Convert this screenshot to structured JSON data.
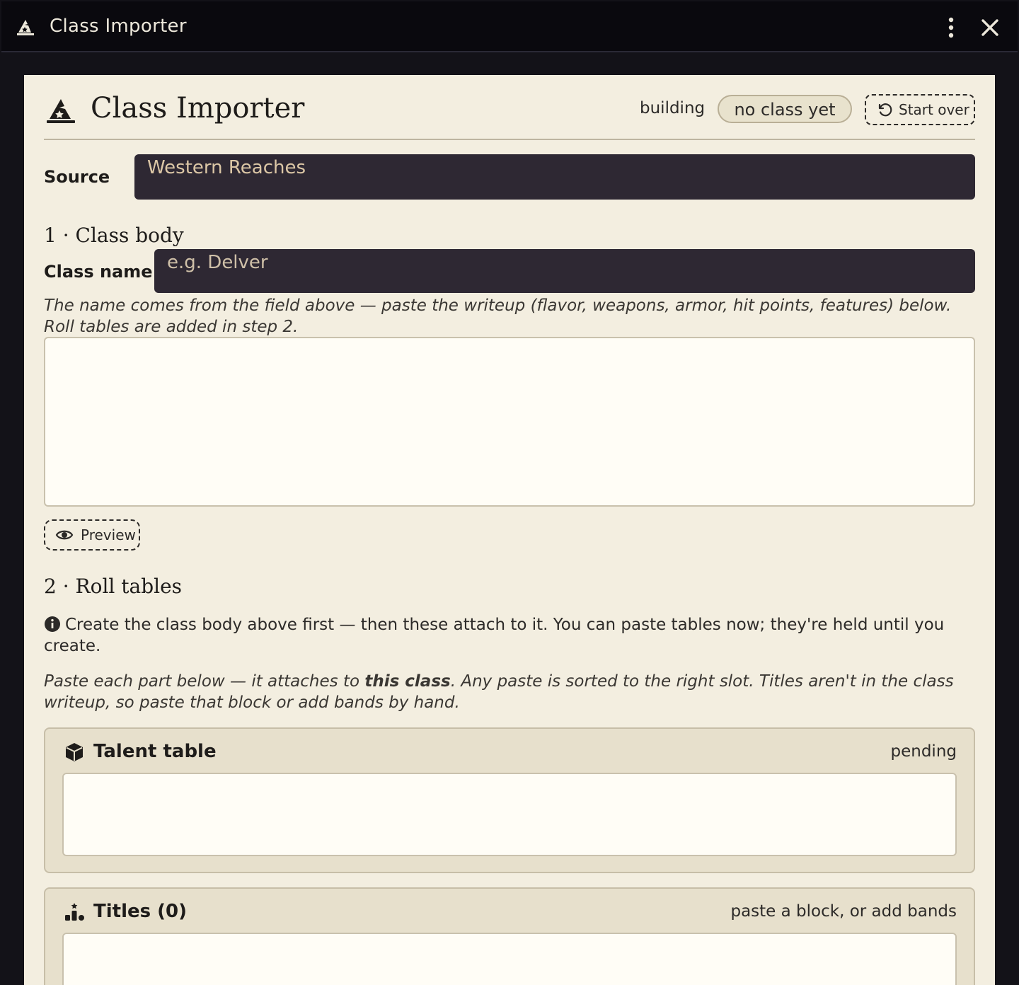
{
  "window": {
    "title": "Class Importer"
  },
  "header": {
    "title": "Class Importer",
    "status_label": "building",
    "status_badge": "no class yet",
    "start_over_label": "Start over"
  },
  "source": {
    "label": "Source",
    "value": "Western Reaches"
  },
  "step1": {
    "title": "1 · Class body",
    "class_name_label": "Class name",
    "class_name_placeholder": "e.g. Delver",
    "hint": "The name comes from the field above — paste the writeup (flavor, weapons, armor, hit points, features) below. Roll tables are added in step 2.",
    "writeup_value": "",
    "preview_label": "Preview"
  },
  "step2": {
    "title": "2 · Roll tables",
    "info": "Create the class body above first — then these attach to it. You can paste tables now; they're held until you create.",
    "hint_before": "Paste each part below — it attaches to ",
    "hint_bold": "this class",
    "hint_after": ". Any paste is sorted to the right slot. Titles aren't in the class writeup, so paste that block or add bands by hand.",
    "talent_table": {
      "title": "Talent table",
      "status": "pending",
      "value": ""
    },
    "titles": {
      "title": "Titles (0)",
      "status": "paste a block, or add bands",
      "value": ""
    }
  },
  "icons": {
    "app": "wizard-hat-icon",
    "menu": "kebab-menu-icon",
    "close": "close-icon",
    "start_over": "undo-icon",
    "preview": "eye-icon",
    "info": "info-icon",
    "talent": "cube-icon",
    "titles": "ranking-icon"
  },
  "colors": {
    "titlebar_bg": "#0a090e",
    "panel_bg": "#f3eee0",
    "input_dark_bg": "#2e2833",
    "input_text": "#dcc7a6",
    "card_bg": "#e7e0cc"
  }
}
